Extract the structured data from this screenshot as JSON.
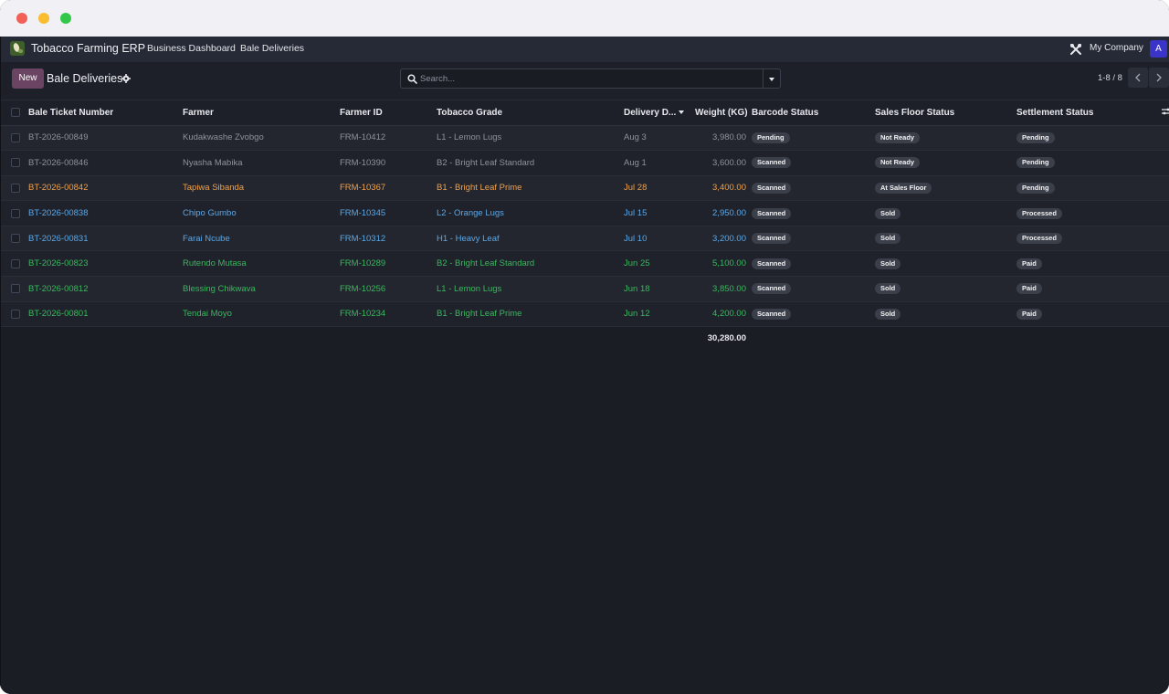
{
  "navbar": {
    "brand": "Tobacco Farming ERP",
    "links": [
      "Business Dashboard",
      "Bale Deliveries"
    ],
    "company": "My Company",
    "avatar_letter": "A"
  },
  "control": {
    "new_label": "New",
    "title": "Bale Deliveries",
    "search_placeholder": "Search...",
    "pager": "1-8 / 8"
  },
  "table": {
    "columns": [
      "Bale Ticket Number",
      "Farmer",
      "Farmer ID",
      "Tobacco Grade",
      "Delivery D...",
      "Weight (KG)",
      "Barcode Status",
      "Sales Floor Status",
      "Settlement Status"
    ],
    "rows": [
      {
        "ticket": "BT-2026-00849",
        "farmer": "Kudakwashe Zvobgo",
        "farmer_id": "FRM-10412",
        "grade": "L1 - Lemon Lugs",
        "date": "Aug 3",
        "weight": "3,980.00",
        "barcode": "Pending",
        "sales_floor": "Not Ready",
        "settlement": "Pending",
        "color": "grey"
      },
      {
        "ticket": "BT-2026-00846",
        "farmer": "Nyasha Mabika",
        "farmer_id": "FRM-10390",
        "grade": "B2 - Bright Leaf Standard",
        "date": "Aug 1",
        "weight": "3,600.00",
        "barcode": "Scanned",
        "sales_floor": "Not Ready",
        "settlement": "Pending",
        "color": "grey"
      },
      {
        "ticket": "BT-2026-00842",
        "farmer": "Tapiwa Sibanda",
        "farmer_id": "FRM-10367",
        "grade": "B1 - Bright Leaf Prime",
        "date": "Jul 28",
        "weight": "3,400.00",
        "barcode": "Scanned",
        "sales_floor": "At Sales Floor",
        "settlement": "Pending",
        "color": "orange"
      },
      {
        "ticket": "BT-2026-00838",
        "farmer": "Chipo Gumbo",
        "farmer_id": "FRM-10345",
        "grade": "L2 - Orange Lugs",
        "date": "Jul 15",
        "weight": "2,950.00",
        "barcode": "Scanned",
        "sales_floor": "Sold",
        "settlement": "Processed",
        "color": "blue"
      },
      {
        "ticket": "BT-2026-00831",
        "farmer": "Farai Ncube",
        "farmer_id": "FRM-10312",
        "grade": "H1 - Heavy Leaf",
        "date": "Jul 10",
        "weight": "3,200.00",
        "barcode": "Scanned",
        "sales_floor": "Sold",
        "settlement": "Processed",
        "color": "blue"
      },
      {
        "ticket": "BT-2026-00823",
        "farmer": "Rutendo Mutasa",
        "farmer_id": "FRM-10289",
        "grade": "B2 - Bright Leaf Standard",
        "date": "Jun 25",
        "weight": "5,100.00",
        "barcode": "Scanned",
        "sales_floor": "Sold",
        "settlement": "Paid",
        "color": "green"
      },
      {
        "ticket": "BT-2026-00812",
        "farmer": "Blessing Chikwava",
        "farmer_id": "FRM-10256",
        "grade": "L1 - Lemon Lugs",
        "date": "Jun 18",
        "weight": "3,850.00",
        "barcode": "Scanned",
        "sales_floor": "Sold",
        "settlement": "Paid",
        "color": "green"
      },
      {
        "ticket": "BT-2026-00801",
        "farmer": "Tendai Moyo",
        "farmer_id": "FRM-10234",
        "grade": "B1 - Bright Leaf Prime",
        "date": "Jun 12",
        "weight": "4,200.00",
        "barcode": "Scanned",
        "sales_floor": "Sold",
        "settlement": "Paid",
        "color": "green"
      }
    ],
    "total_weight": "30,280.00"
  },
  "colors": {
    "grey": "#8e929d",
    "orange": "#f0a048",
    "blue": "#5aa8e8",
    "green": "#39b85d",
    "accent": "#6b4463",
    "avatar": "#3a34c9"
  },
  "icons": {
    "brand": "tobacco-leaf-logo",
    "tools": "tools-icon",
    "gear": "gear-icon",
    "search": "search-icon",
    "dropdown": "caret-down-icon",
    "prev": "chevron-left-icon",
    "next": "chevron-right-icon",
    "adjust": "sliders-icon"
  }
}
